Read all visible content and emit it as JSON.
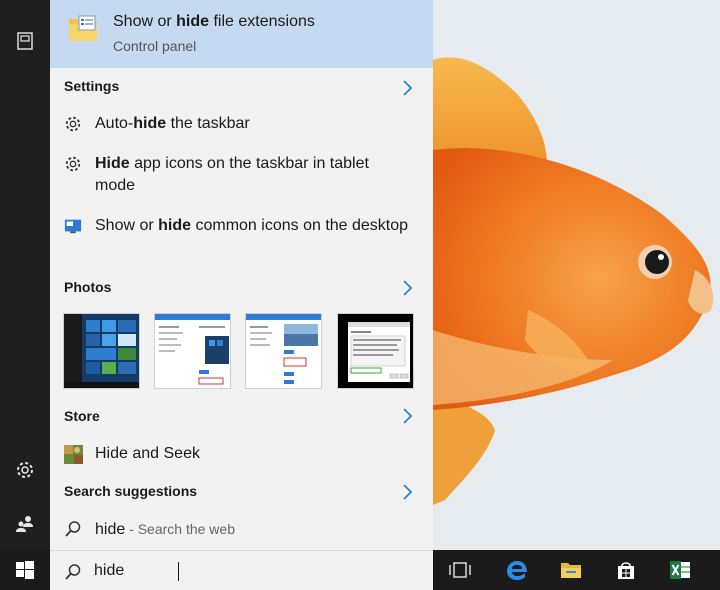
{
  "best_match": {
    "title_pre": "Show or ",
    "title_bold": "hide",
    "title_post": " file extensions",
    "subtitle": "Control panel",
    "icon": "folder-options-icon"
  },
  "sections": {
    "settings": "Settings",
    "photos": "Photos",
    "store": "Store",
    "suggestions": "Search suggestions"
  },
  "settings_items": [
    {
      "pre": "Auto-",
      "bold": "hide",
      "post": " the taskbar",
      "icon": "gear-icon"
    },
    {
      "pre": "",
      "bold": "Hide",
      "post": " app icons on the taskbar in tablet mode",
      "icon": "gear-icon"
    },
    {
      "pre": "Show or ",
      "bold": "hide",
      "post": " common icons on the desktop",
      "icon": "desktop-icons-icon"
    }
  ],
  "photos": [
    {
      "name": "start-menu-screenshot"
    },
    {
      "name": "settings-dialog-screenshot"
    },
    {
      "name": "settings-window-screenshot"
    },
    {
      "name": "file-dialog-screenshot"
    }
  ],
  "store_item": {
    "label": "Hide and Seek",
    "icon": "game-icon"
  },
  "suggestion": {
    "query": "hide",
    "hint": " - Search the web"
  },
  "search": {
    "value": "hide"
  },
  "colors": {
    "best_match_bg": "#c5daf0",
    "panel_bg": "#f2f2f2",
    "rail_bg": "#1f1f1f",
    "taskbar_bg": "#1b1b1b",
    "accent": "#2d7bd6"
  },
  "taskbar_icons": [
    "task-view-icon",
    "edge-icon",
    "file-explorer-icon",
    "store-icon",
    "excel-icon"
  ],
  "rail_icons": [
    "documents-icon",
    "settings-icon",
    "people-icon"
  ]
}
